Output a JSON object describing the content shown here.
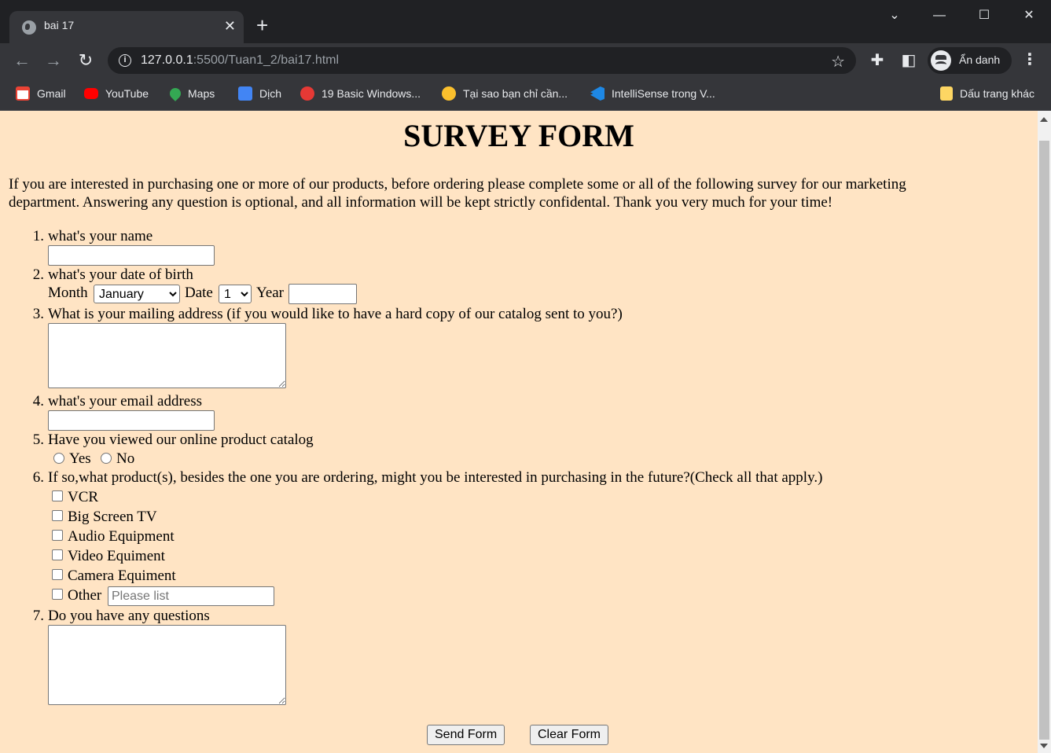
{
  "browser": {
    "tab_title": "bai 17",
    "url_host": "127.0.0.1",
    "url_rest": ":5500/Tuan1_2/bai17.html",
    "profile_label": "Ẩn danh",
    "bookmarks": [
      {
        "label": "Gmail",
        "icon": "gmail-icon",
        "color": "#ea4335"
      },
      {
        "label": "YouTube",
        "icon": "youtube-icon",
        "color": "#ff0000"
      },
      {
        "label": "Maps",
        "icon": "maps-icon",
        "color": "#34a853"
      },
      {
        "label": "Dịch",
        "icon": "translate-icon",
        "color": "#4285f4"
      },
      {
        "label": "19 Basic Windows...",
        "icon": "site-icon",
        "color": "#e53935"
      },
      {
        "label": "Tại sao bạn chỉ cần...",
        "icon": "bulb-icon",
        "color": "#fbc02d"
      },
      {
        "label": "IntelliSense trong V...",
        "icon": "vscode-icon",
        "color": "#1e88e5"
      }
    ],
    "other_bookmarks": "Dấu trang khác"
  },
  "page": {
    "title": "SURVEY FORM",
    "intro": "If you are interested in purchasing one or more of our products, before ordering please complete some or all of the following survey for our marketing department. Answering any question is optional, and all information will be kept strictly confidental. Thank you very much for your time!",
    "q1": {
      "num": "1.",
      "label": "what's your name",
      "value": ""
    },
    "q2": {
      "num": "2.",
      "label": "what's your date of birth",
      "month_label": "Month",
      "month_value": "January",
      "date_label": "Date",
      "date_value": "1",
      "year_label": "Year",
      "year_value": ""
    },
    "q3": {
      "num": "3.",
      "label": "What is your mailing address (if you would like to have a hard copy of our catalog sent to you?)"
    },
    "q4": {
      "num": "4.",
      "label": "what's your email address",
      "value": ""
    },
    "q5": {
      "num": "5.",
      "label": "Have you viewed our online product catalog",
      "yes": "Yes",
      "no": "No"
    },
    "q6": {
      "num": "6.",
      "label": "If so,what product(s), besides the one you are ordering, might you be interested in purchasing in the future?(Check all that apply.)",
      "options": [
        "VCR",
        "Big Screen TV",
        "Audio Equipment",
        "Video Equiment",
        "Camera Equiment",
        "Other"
      ],
      "other_placeholder": "Please list"
    },
    "q7": {
      "num": "7.",
      "label": "Do you have any questions"
    },
    "send_label": "Send Form",
    "clear_label": "Clear Form"
  }
}
